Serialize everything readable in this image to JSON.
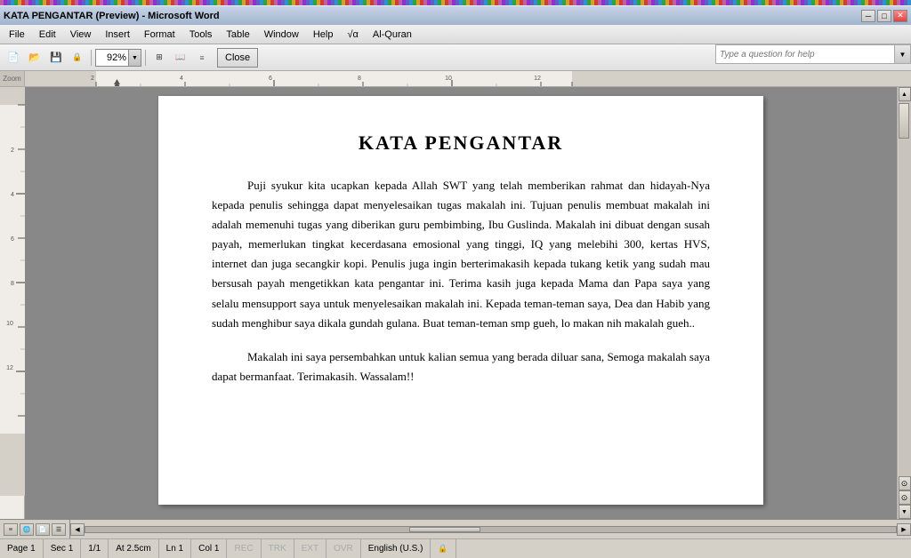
{
  "titleBar": {
    "text": "KATA PENGANTAR (Preview) - Microsoft Word",
    "minBtn": "─",
    "maxBtn": "□",
    "closeBtn": "✕"
  },
  "menuBar": {
    "items": [
      "File",
      "Edit",
      "View",
      "Insert",
      "Format",
      "Tools",
      "Table",
      "Window",
      "Help",
      "√α",
      "Al-Quran"
    ]
  },
  "questionBar": {
    "placeholder": "Type a question for help"
  },
  "toolbar": {
    "zoom": "92%",
    "closeLabel": "Close"
  },
  "ruler": {
    "label": "Zoom"
  },
  "document": {
    "title": "KATA PENGANTAR",
    "paragraph1": "Puji syukur kita ucapkan kepada Allah SWT yang telah memberikan rahmat dan hidayah-Nya kepada penulis sehingga dapat menyelesaikan tugas makalah ini. Tujuan penulis membuat makalah ini adalah memenuhi tugas yang diberikan guru pembimbing, Ibu Guslinda. Makalah ini dibuat dengan susah payah, memerlukan tingkat kecerdasana emosional yang tinggi, IQ yang melebihi 300, kertas HVS, internet dan juga secangkir kopi. Penulis juga ingin berterimakasih kepada tukang ketik yang sudah mau bersusah payah mengetikkan kata pengantar ini. Terima kasih juga kepada Mama dan Papa saya yang selalu mensupport saya untuk menyelesaikan makalah ini. Kepada teman-teman saya, Dea dan Habib yang sudah menghibur saya dikala gundah gulana. Buat teman-teman smp gueh, lo makan nih makalah gueh..",
    "paragraph2": "Makalah ini saya persembahkan untuk kalian semua yang berada diluar sana, Semoga makalah saya dapat bermanfaat. Terimakasih. Wassalam!!"
  },
  "statusBar": {
    "page": "Page 1",
    "sec": "Sec 1",
    "pageCount": "1/1",
    "at": "At 2.5cm",
    "ln": "Ln 1",
    "col": "Col 1",
    "rec": "REC",
    "trk": "TRK",
    "ext": "EXT",
    "ovr": "OVR",
    "lang": "English (U.S.)"
  }
}
